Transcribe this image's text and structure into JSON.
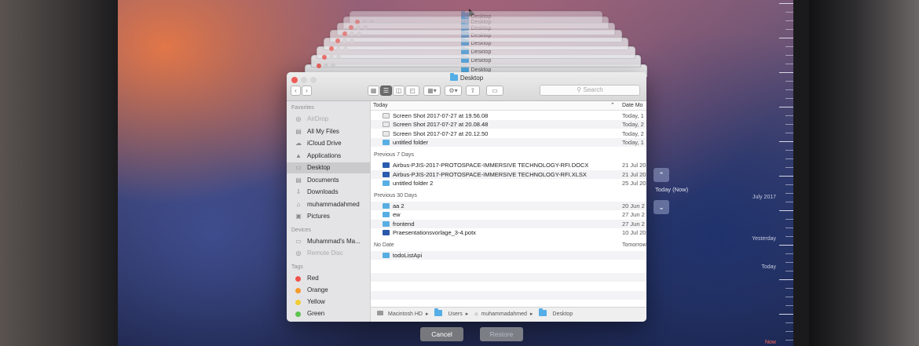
{
  "stack": {
    "titles": [
      "Desktop",
      "Desktop",
      "Desktop",
      "Desktop",
      "Desktop",
      "Desktop",
      "Desktop",
      "Desktop"
    ]
  },
  "window": {
    "title": "Desktop",
    "search_placeholder": "Search",
    "sidebar": {
      "favorites_header": "Favorites",
      "favorites": [
        "AirDrop",
        "All My Files",
        "iCloud Drive",
        "Applications",
        "Desktop",
        "Documents",
        "Downloads",
        "muhammadahmed",
        "Pictures"
      ],
      "devices_header": "Devices",
      "devices": [
        "Muhammad's Ma...",
        "Remote Disc"
      ],
      "tags_header": "Tags",
      "tags": [
        {
          "label": "Red",
          "color": "#f0524b"
        },
        {
          "label": "Orange",
          "color": "#f59a2c"
        },
        {
          "label": "Yellow",
          "color": "#f2cd34"
        },
        {
          "label": "Green",
          "color": "#5cc34e"
        }
      ]
    },
    "columns": {
      "name": "Today",
      "date": "Date Mo"
    },
    "groups": [
      {
        "label": "Today",
        "items": [
          {
            "name": "Screen Shot 2017-07-27 at 19.56.08",
            "date": "Today, 1",
            "icon": "file"
          },
          {
            "name": "Screen Shot 2017-07-27 at 20.08.48",
            "date": "Today, 2",
            "icon": "file"
          },
          {
            "name": "Screen Shot 2017-07-27 at 20.12.50",
            "date": "Today, 2",
            "icon": "file"
          },
          {
            "name": "untitled folder",
            "date": "Today, 1",
            "icon": "folder"
          }
        ]
      },
      {
        "label": "Previous 7 Days",
        "items": [
          {
            "name": "Airbus-PJIS-2017-PROTOSPACE-IMMERSIVE TECHNOLOGY-RFI.DOCX",
            "date": "21 Jul 20",
            "icon": "doc"
          },
          {
            "name": "Airbus-PJIS-2017-PROTOSPACE-IMMERSIVE TECHNOLOGY-RFI.XLSX",
            "date": "21 Jul 20",
            "icon": "doc"
          },
          {
            "name": "untitled folder 2",
            "date": "25 Jul 20",
            "icon": "folder"
          }
        ]
      },
      {
        "label": "Previous 30 Days",
        "items": [
          {
            "name": "aa 2",
            "date": "20 Jun 2",
            "icon": "folder"
          },
          {
            "name": "ew",
            "date": "27 Jun 2",
            "icon": "folder"
          },
          {
            "name": "frontend",
            "date": "27 Jun 2",
            "icon": "folder"
          },
          {
            "name": "Praesentationsvorlage_3-4.potx",
            "date": "10 Jul 20",
            "icon": "ppt"
          }
        ]
      },
      {
        "label": "No Date",
        "date": "Tomorrow",
        "items": [
          {
            "name": "todoListApi",
            "date": "",
            "icon": "folder"
          }
        ]
      }
    ],
    "pathbar": [
      "Macintosh HD",
      "Users",
      "muhammadahmed",
      "Desktop"
    ]
  },
  "buttons": {
    "cancel": "Cancel",
    "restore": "Restore"
  },
  "time_machine": {
    "current_label": "Today (Now)",
    "timeline_labels": [
      "July 2017",
      "Yesterday",
      "Today",
      "Now"
    ]
  },
  "colors": {
    "accent": "#55aee6",
    "selected_sidebar": "#cacacd",
    "traffic_red": "#ee5c55"
  }
}
